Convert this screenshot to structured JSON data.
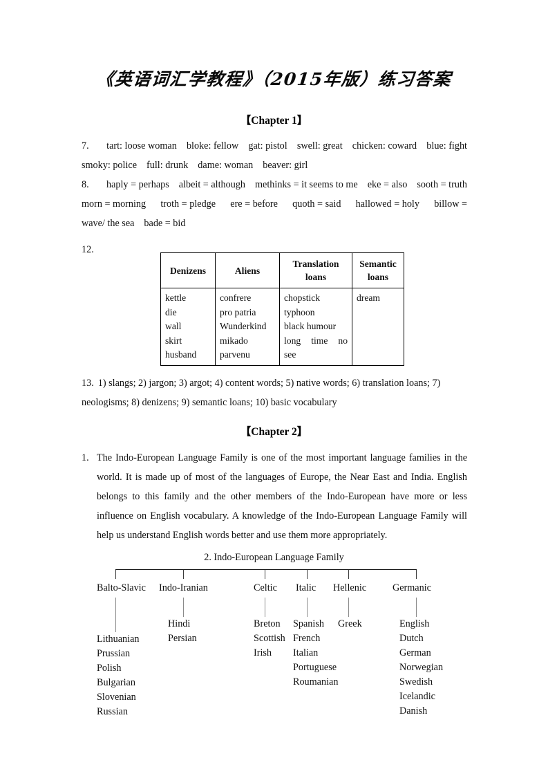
{
  "document": {
    "title": "《英语词汇学教程》（2015年版）练习答案"
  },
  "chapter1": {
    "heading": "【Chapter 1】",
    "q7": {
      "number": "7.",
      "line1": [
        "tart: loose woman",
        "bloke: fellow",
        "gat: pistol",
        "swell: great",
        "chicken: coward",
        "blue: fight"
      ],
      "line2": [
        "smoky: police",
        "full: drunk",
        "dame: woman",
        "beaver: girl"
      ]
    },
    "q8": {
      "number": "8.",
      "line1": [
        "haply = perhaps",
        "albeit = although",
        "methinks = it seems to me",
        "eke = also",
        "sooth = truth"
      ],
      "line2": [
        "morn = morning",
        "troth = pledge",
        "ere = before",
        "quoth = said",
        "hallowed  =  holy",
        "billow  ="
      ],
      "line3": [
        "wave/ the sea",
        "bade = bid"
      ]
    },
    "q12": {
      "number": "12.",
      "table": {
        "headers": [
          "Denizens",
          "Aliens",
          "Translation loans",
          "Semantic loans"
        ],
        "columns": [
          [
            "kettle",
            "die",
            "wall",
            "skirt",
            "husband"
          ],
          [
            "confrere",
            "pro patria",
            "Wunderkind",
            "mikado",
            "parvenu"
          ],
          [
            "chopstick",
            "typhoon",
            "black humour",
            "long time no",
            "see"
          ],
          [
            "dream"
          ]
        ]
      }
    },
    "q13": {
      "number": "13.",
      "line1": "1) slangs; 2) jargon; 3) argot; 4) content words; 5) native words; 6) translation loans; 7)",
      "line2": "neologisms;    8) denizens; 9) semantic loans; 10) basic vocabulary"
    }
  },
  "chapter2": {
    "heading": "【Chapter 2】",
    "q1": {
      "number": "1.",
      "text": "The Indo-European Language Family is one of the most important language families in the world. It is made up of most of the languages of Europe, the Near East and India. English belongs to this family and the other members of the Indo-European have more or less influence on English vocabulary. A knowledge of the Indo-European Language Family will help us understand English words better and use them more appropriately."
    },
    "q2": {
      "title": "2. Indo-European Language Family",
      "branches": [
        {
          "label": "Balto-Slavic",
          "languages": [
            "Lithuanian",
            "Prussian",
            "Polish",
            "Bulgarian",
            "Slovenian",
            "Russian"
          ],
          "first_item_offset_rows": 1
        },
        {
          "label": "Indo-Iranian",
          "languages": [
            "Hindi",
            "Persian"
          ],
          "first_item_offset_rows": 0
        },
        {
          "label": "Celtic",
          "languages": [
            "Breton",
            "Scottish",
            "Irish"
          ],
          "first_item_offset_rows": 0
        },
        {
          "label": "Italic",
          "languages": [
            "Spanish",
            "French",
            "Italian",
            "Portuguese",
            "Roumanian"
          ],
          "first_item_offset_rows": 0
        },
        {
          "label": "Hellenic",
          "languages": [
            "Greek"
          ],
          "first_item_offset_rows": 0
        },
        {
          "label": "Germanic",
          "languages": [
            "English",
            "Dutch",
            "German",
            "Norwegian",
            "Swedish",
            "Icelandic",
            "Danish"
          ],
          "first_item_offset_rows": 0
        }
      ]
    }
  }
}
